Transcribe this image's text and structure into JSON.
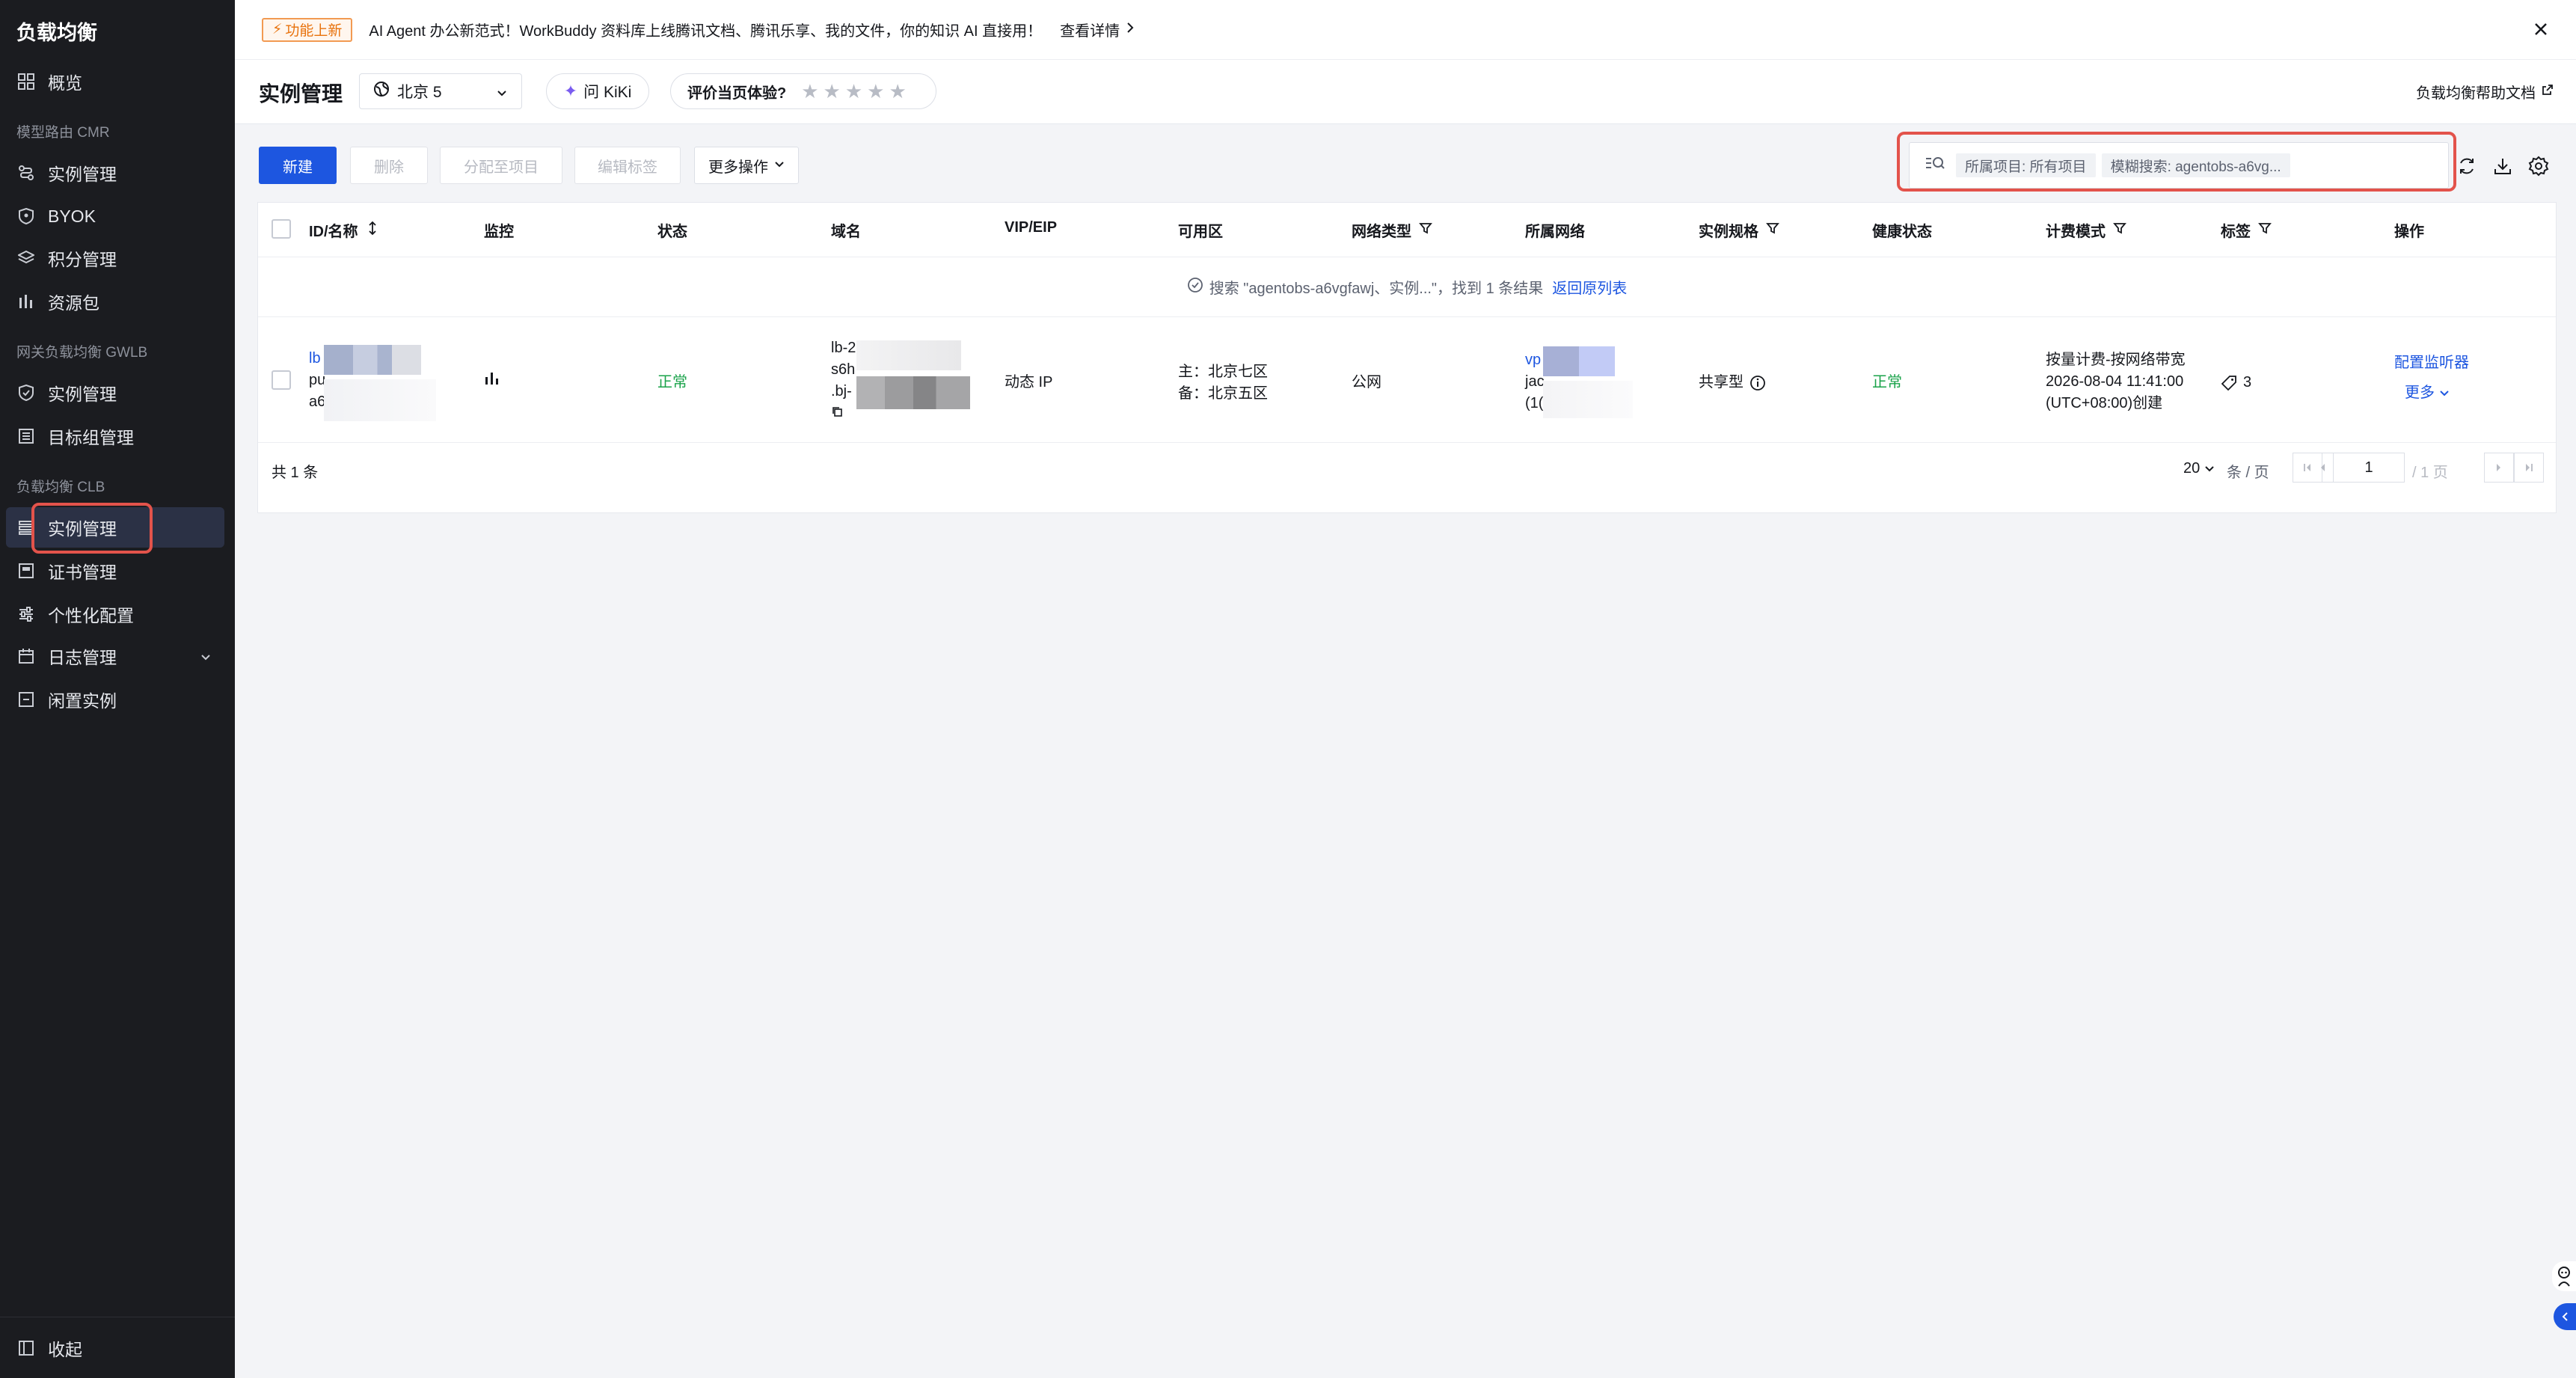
{
  "sidebar": {
    "title": "负载均衡",
    "overview": "概览",
    "sections": {
      "cmr": "模型路由 CMR",
      "gwlb": "网关负载均衡 GWLB",
      "clb": "负载均衡 CLB"
    },
    "cmr_items": [
      "实例管理",
      "BYOK",
      "积分管理",
      "资源包"
    ],
    "gwlb_items": [
      "实例管理",
      "目标组管理"
    ],
    "clb_items": [
      "实例管理",
      "证书管理",
      "个性化配置",
      "日志管理",
      "闲置实例"
    ],
    "collapse": "收起"
  },
  "banner": {
    "tag": "功能上新",
    "text": "AI Agent 办公新范式！WorkBuddy 资料库上线腾讯文档、腾讯乐享、我的文件，你的知识 AI 直接用！",
    "link": "查看详情"
  },
  "header": {
    "title": "实例管理",
    "region": "北京 5",
    "kiki": "问 KiKi",
    "rating_label": "评价当页体验?",
    "stars": "★★★★★",
    "help": "负载均衡帮助文档"
  },
  "toolbar": {
    "new": "新建",
    "delete": "删除",
    "assign_project": "分配至项目",
    "edit_tags": "编辑标签",
    "more_actions": "更多操作",
    "search_chips": [
      "所属项目: 所有项目",
      "模糊搜索: agentobs-a6vg..."
    ]
  },
  "table": {
    "columns": [
      "ID/名称",
      "监控",
      "状态",
      "域名",
      "VIP/EIP",
      "可用区",
      "网络类型",
      "所属网络",
      "实例规格",
      "健康状态",
      "计费模式",
      "标签",
      "操作"
    ],
    "result_text": "搜索 \"agentobs-a6vgfawj、实例...\"，找到 1 条结果",
    "result_back": "返回原列表",
    "row": {
      "id_lines": [
        "lb",
        "pu",
        "a6"
      ],
      "status": "正常",
      "domain_lines": [
        "lb-2",
        "s6h",
        ".bj-"
      ],
      "vip": "动态 IP",
      "zone_main": "主：北京七区",
      "zone_backup": "备：北京五区",
      "network_type": "公网",
      "vpc_lines": [
        "vp",
        "jac",
        "(1("
      ],
      "spec": "共享型",
      "health": "正常",
      "billing_lines": [
        "按量计费-按网络带宽",
        "2026-08-04 11:41:00",
        "(UTC+08:00)创建"
      ],
      "tag_count": "3",
      "op_config": "配置监听器",
      "op_more": "更多"
    },
    "total": "共 1 条",
    "page_size": "20",
    "page_size_unit": "条 / 页",
    "page_current": "1",
    "page_total": "/ 1 页"
  },
  "colors": {
    "primary": "#1d56e0",
    "success": "#1aa34a",
    "highlight": "#e3534b",
    "sidebar_bg": "#1b1c20"
  }
}
